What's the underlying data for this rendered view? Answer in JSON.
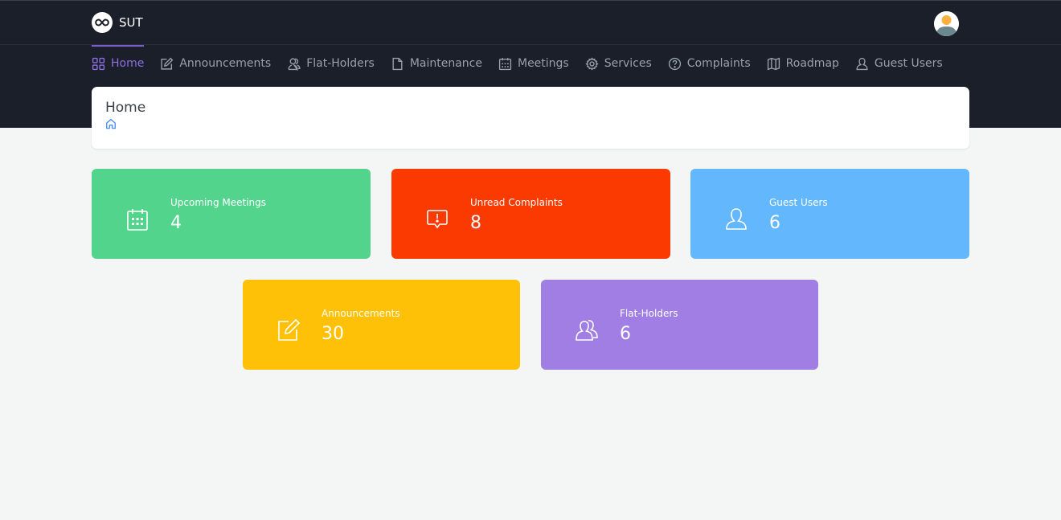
{
  "brand": {
    "name": "SUT"
  },
  "nav": {
    "items": [
      {
        "label": "Home",
        "icon": "grid-icon",
        "active": true
      },
      {
        "label": "Announcements",
        "icon": "edit-icon",
        "active": false
      },
      {
        "label": "Flat-Holders",
        "icon": "users-icon",
        "active": false
      },
      {
        "label": "Maintenance",
        "icon": "file-icon",
        "active": false
      },
      {
        "label": "Meetings",
        "icon": "calendar-icon",
        "active": false
      },
      {
        "label": "Services",
        "icon": "gear-icon",
        "active": false
      },
      {
        "label": "Complaints",
        "icon": "help-circle-icon",
        "active": false
      },
      {
        "label": "Roadmap",
        "icon": "map-icon",
        "active": false
      },
      {
        "label": "Guest Users",
        "icon": "user-icon",
        "active": false
      }
    ]
  },
  "page": {
    "title": "Home",
    "breadcrumb_icon": "home-icon"
  },
  "stats": [
    {
      "label": "Upcoming Meetings",
      "value": "4",
      "icon": "calendar-icon",
      "color": "#52d48c"
    },
    {
      "label": "Unread Complaints",
      "value": "8",
      "icon": "alert-message-icon",
      "color": "#fa3a00"
    },
    {
      "label": "Guest Users",
      "value": "6",
      "icon": "user-icon",
      "color": "#63b8fd"
    },
    {
      "label": "Announcements",
      "value": "30",
      "icon": "edit-icon",
      "color": "#fec107"
    },
    {
      "label": "Flat-Holders",
      "value": "6",
      "icon": "users-icon",
      "color": "#a07ee4"
    }
  ],
  "colors": {
    "header_bg": "#1a1f29",
    "accent": "#8e6ee0",
    "page_bg": "#f4f5f5",
    "breadcrumb_icon": "#3b82f6"
  }
}
